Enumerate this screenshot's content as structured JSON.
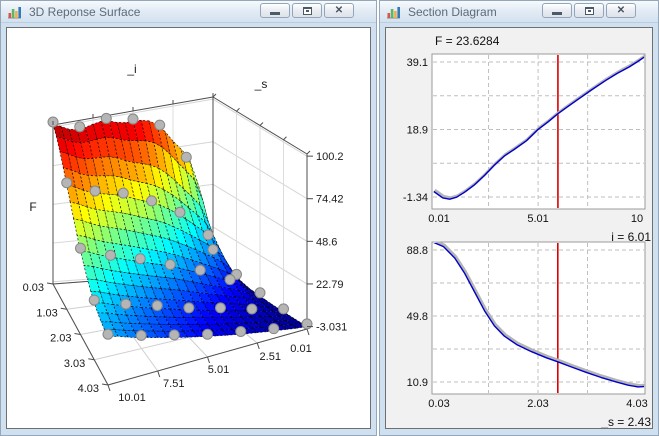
{
  "left_window": {
    "title": "3D Reponse Surface",
    "controls": {
      "minimize": "minimize",
      "maximize": "maximize",
      "close": "close",
      "close_glyph": "✕"
    }
  },
  "right_window": {
    "title": "Section Diagram",
    "controls": {
      "minimize": "minimize",
      "maximize": "maximize",
      "close": "close",
      "close_glyph": "✕"
    }
  },
  "icon_bar_colors": [
    "#d9534f",
    "#5cb85c",
    "#f0ad4e",
    "#337ab7"
  ],
  "accent_colors": {
    "curve": "#0000cc",
    "cursor": "#dd0000",
    "shadow": "#b4b4b4",
    "grid": "#bfbfbf",
    "sphere": "#b5b5b5"
  },
  "chart_data": [
    {
      "type": "surface3d",
      "name": "response-surface",
      "axes": {
        "x": {
          "label": "_i",
          "ticks": [
            "10.01",
            "7.51",
            "5.01",
            "2.51",
            "0.01"
          ],
          "tick_values": [
            10.01,
            7.51,
            5.01,
            2.51,
            0.01
          ]
        },
        "y": {
          "label": "_s",
          "ticks": [
            "0.03",
            "1.03",
            "2.03",
            "3.03",
            "4.03"
          ],
          "tick_values": [
            0.03,
            1.03,
            2.03,
            3.03,
            4.03
          ]
        },
        "z": {
          "label": "F",
          "ticks": [
            "-3.031",
            "22.79",
            "48.6",
            "74.42",
            "100.2"
          ],
          "tick_values": [
            -3.031,
            22.79,
            48.6,
            74.42,
            100.2
          ]
        }
      },
      "grid_i": [
        0.01,
        1.26,
        2.51,
        3.76,
        5.01,
        6.26,
        7.51,
        8.76,
        10.01
      ],
      "grid_s": [
        0.03,
        0.53,
        1.03,
        1.53,
        2.03,
        2.53,
        3.03,
        3.53,
        4.03
      ],
      "F": [
        [
          6.0,
          2.2,
          0.3,
          -1.0,
          -1.8,
          -2.4,
          -2.7,
          -2.9,
          -3.0
        ],
        [
          61.2,
          38.1,
          24.5,
          15.0,
          8.5,
          4.0,
          1.2,
          -0.3,
          -0.8
        ],
        [
          79.9,
          54.7,
          37.4,
          24.6,
          15.3,
          8.9,
          4.8,
          2.5,
          1.9
        ],
        [
          90.0,
          66.3,
          47.5,
          32.8,
          21.7,
          13.9,
          8.7,
          5.9,
          5.0
        ],
        [
          96.6,
          75.6,
          56.4,
          40.4,
          28.1,
          19.1,
          12.9,
          9.9,
          8.6
        ],
        [
          96.6,
          79.3,
          61.5,
          45.9,
          33.3,
          23.9,
          17.4,
          14.0,
          12.6
        ],
        [
          96.2,
          82.3,
          66.0,
          51.3,
          38.6,
          29.0,
          22.2,
          18.7,
          17.2
        ],
        [
          98.2,
          86.7,
          72.0,
          57.5,
          44.8,
          34.8,
          27.7,
          23.7,
          22.2
        ],
        [
          100.2,
          90.9,
          77.4,
          63.7,
          51.0,
          40.8,
          33.5,
          29.1,
          27.7
        ]
      ],
      "marker_points": {
        "i": [
          0.01,
          1.68,
          3.34,
          5.01,
          6.68,
          8.34,
          10.01
        ],
        "s": [
          0.03,
          1.03,
          2.03,
          3.03,
          4.03
        ]
      }
    },
    {
      "type": "line",
      "name": "section-vs-i",
      "title": "F = 23.6284",
      "cursor_x": 6.01,
      "cursor_label": "_i = 6.01",
      "x_ticks": [
        "0.01",
        "5.01",
        "10"
      ],
      "x_tick_values": [
        0.01,
        5.01,
        10
      ],
      "x_grid_values": [
        2.51,
        5.01,
        7.51
      ],
      "y_ticks": [
        "39.1",
        "18.9",
        "-1.34"
      ],
      "y_tick_values": [
        39.1,
        18.9,
        -1.34
      ],
      "y_grid_values": [
        39.1,
        28.99,
        18.88,
        8.77,
        -1.34
      ],
      "x": [
        -0.25,
        0.2,
        0.55,
        0.9,
        1.3,
        1.8,
        2.3,
        2.8,
        3.3,
        3.8,
        4.4,
        5.01,
        5.5,
        6.01,
        6.5,
        7.0,
        7.7,
        8.4,
        9.0,
        9.6,
        10.0,
        10.38
      ],
      "y": [
        0.3,
        -1.6,
        -2.0,
        -1.4,
        0.1,
        2.3,
        5.1,
        8.2,
        10.9,
        12.9,
        15.4,
        18.9,
        21.1,
        23.6,
        25.7,
        27.8,
        30.7,
        33.5,
        35.7,
        37.6,
        39.1,
        40.6
      ]
    },
    {
      "type": "line",
      "name": "section-vs-s",
      "title": "",
      "cursor_x": 2.43,
      "cursor_label": "_s = 2.43",
      "x_ticks": [
        "0.03",
        "2.03",
        "4.03"
      ],
      "x_tick_values": [
        0.03,
        2.03,
        4.03
      ],
      "x_grid_values": [
        1.03,
        2.03,
        3.03
      ],
      "y_ticks": [
        "88.8",
        "49.8",
        "10.9"
      ],
      "y_tick_values": [
        88.8,
        49.8,
        10.9
      ],
      "y_grid_values": [
        88.8,
        69.33,
        49.85,
        30.38,
        10.9
      ],
      "x": [
        -0.1,
        0.12,
        0.35,
        0.55,
        0.75,
        0.95,
        1.15,
        1.35,
        1.6,
        1.9,
        2.2,
        2.43,
        2.7,
        3.0,
        3.3,
        3.6,
        3.85,
        4.05,
        4.25
      ],
      "y": [
        93.5,
        90.8,
        84.0,
        75.0,
        64.0,
        53.0,
        44.0,
        38.0,
        33.0,
        28.8,
        25.2,
        22.8,
        19.8,
        16.6,
        13.6,
        11.0,
        9.0,
        8.0,
        8.3
      ]
    }
  ]
}
